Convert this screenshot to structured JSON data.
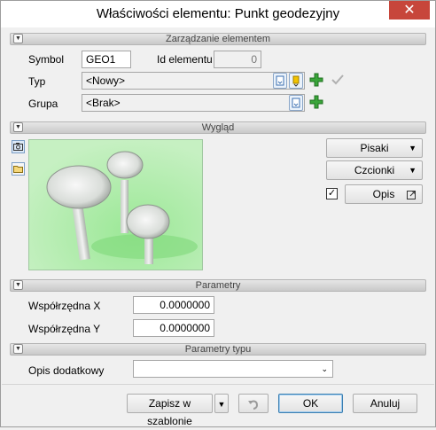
{
  "window": {
    "title": "Właściwości elementu: Punkt geodezyjny",
    "close_glyph": "✕"
  },
  "sections": {
    "management": "Zarządzanie elementem",
    "appearance": "Wygląd",
    "parameters": "Parametry",
    "type_parameters": "Parametry typu"
  },
  "management": {
    "symbol_label": "Symbol",
    "symbol_value": "GEO1",
    "id_label": "Id elementu",
    "id_value": "0",
    "type_label": "Typ",
    "type_value": "<Nowy>",
    "group_label": "Grupa",
    "group_value": "<Brak>"
  },
  "appearance": {
    "pens_label": "Pisaki",
    "fonts_label": "Czcionki",
    "description_label": "Opis",
    "description_checked": true
  },
  "parameters": {
    "x_label": "Współrzędna X",
    "x_value": "0.0000000",
    "y_label": "Współrzędna Y",
    "y_value": "0.0000000"
  },
  "type_parameters": {
    "extra_desc_label": "Opis dodatkowy",
    "extra_desc_value": ""
  },
  "footer": {
    "save_template_label": "Zapisz w szablonie",
    "ok_label": "OK",
    "cancel_label": "Anuluj"
  },
  "colors": {
    "accent": "#3c7fb1",
    "preview_bg": "#b4eab0",
    "close_bg": "#c7463b"
  }
}
